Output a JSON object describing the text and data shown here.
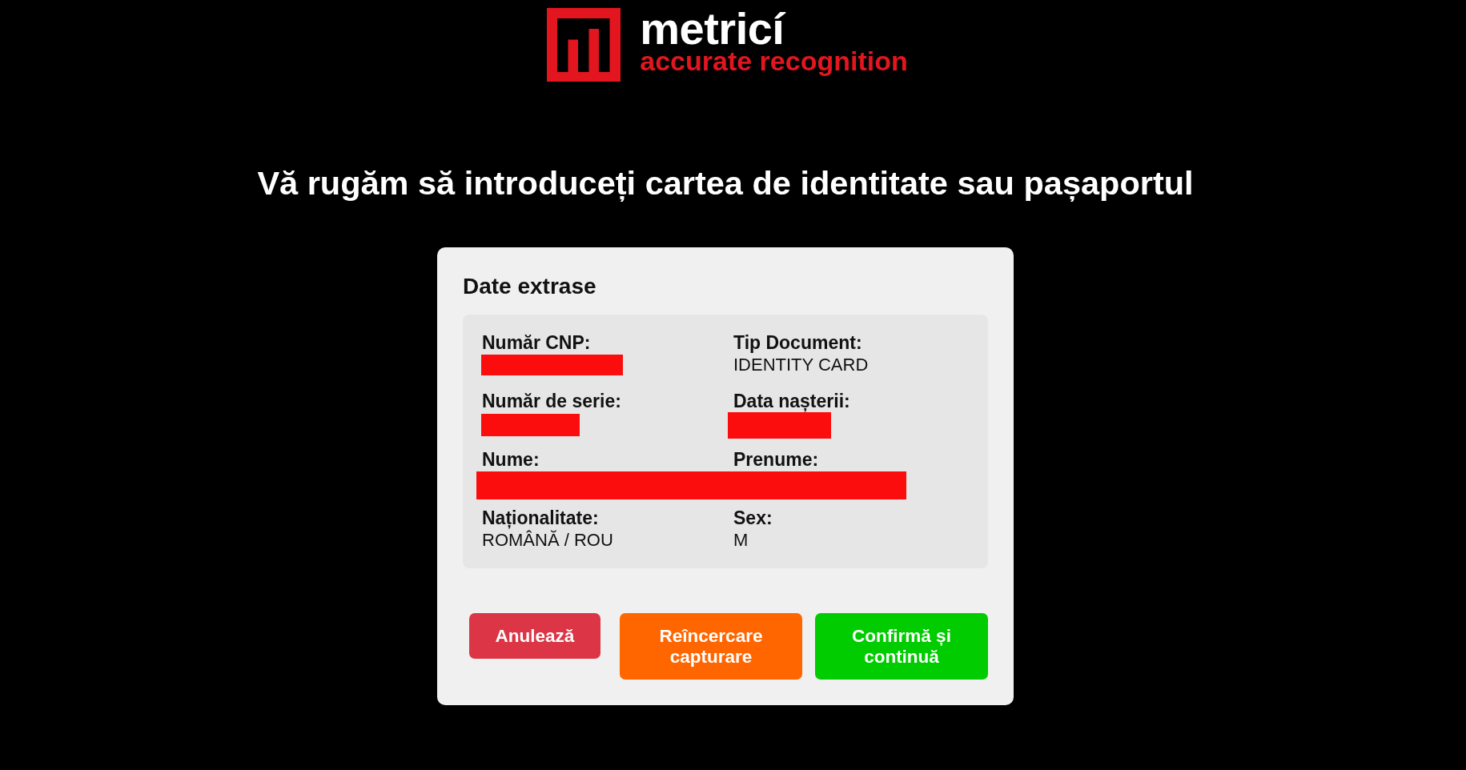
{
  "logo": {
    "name": "metricí",
    "tagline": "accurate recognition"
  },
  "heading": "Vă rugăm să introduceți cartea de identitate sau pașaportul",
  "card": {
    "title": "Date extrase",
    "fields": [
      {
        "label": "Număr CNP:",
        "redacted": true
      },
      {
        "label": "Tip Document:",
        "redacted": false,
        "value": "IDENTITY CARD"
      },
      {
        "label": "Număr de serie:",
        "redacted": true
      },
      {
        "label": "Data nașterii:",
        "redacted": true
      },
      {
        "label": "Nume:",
        "redacted": true,
        "redaction_spans_next": true
      },
      {
        "label": "Prenume:",
        "redacted": true
      },
      {
        "label": "Naționalitate:",
        "redacted": false,
        "value": "ROMÂNĂ / ROU"
      },
      {
        "label": "Sex:",
        "redacted": false,
        "value": "M"
      }
    ],
    "buttons": [
      {
        "label": "Anulează",
        "kind": "cancel"
      },
      {
        "label": "Reîncercare capturare",
        "kind": "retry"
      },
      {
        "label": "Confirmă și continuă",
        "kind": "confirm"
      }
    ]
  }
}
